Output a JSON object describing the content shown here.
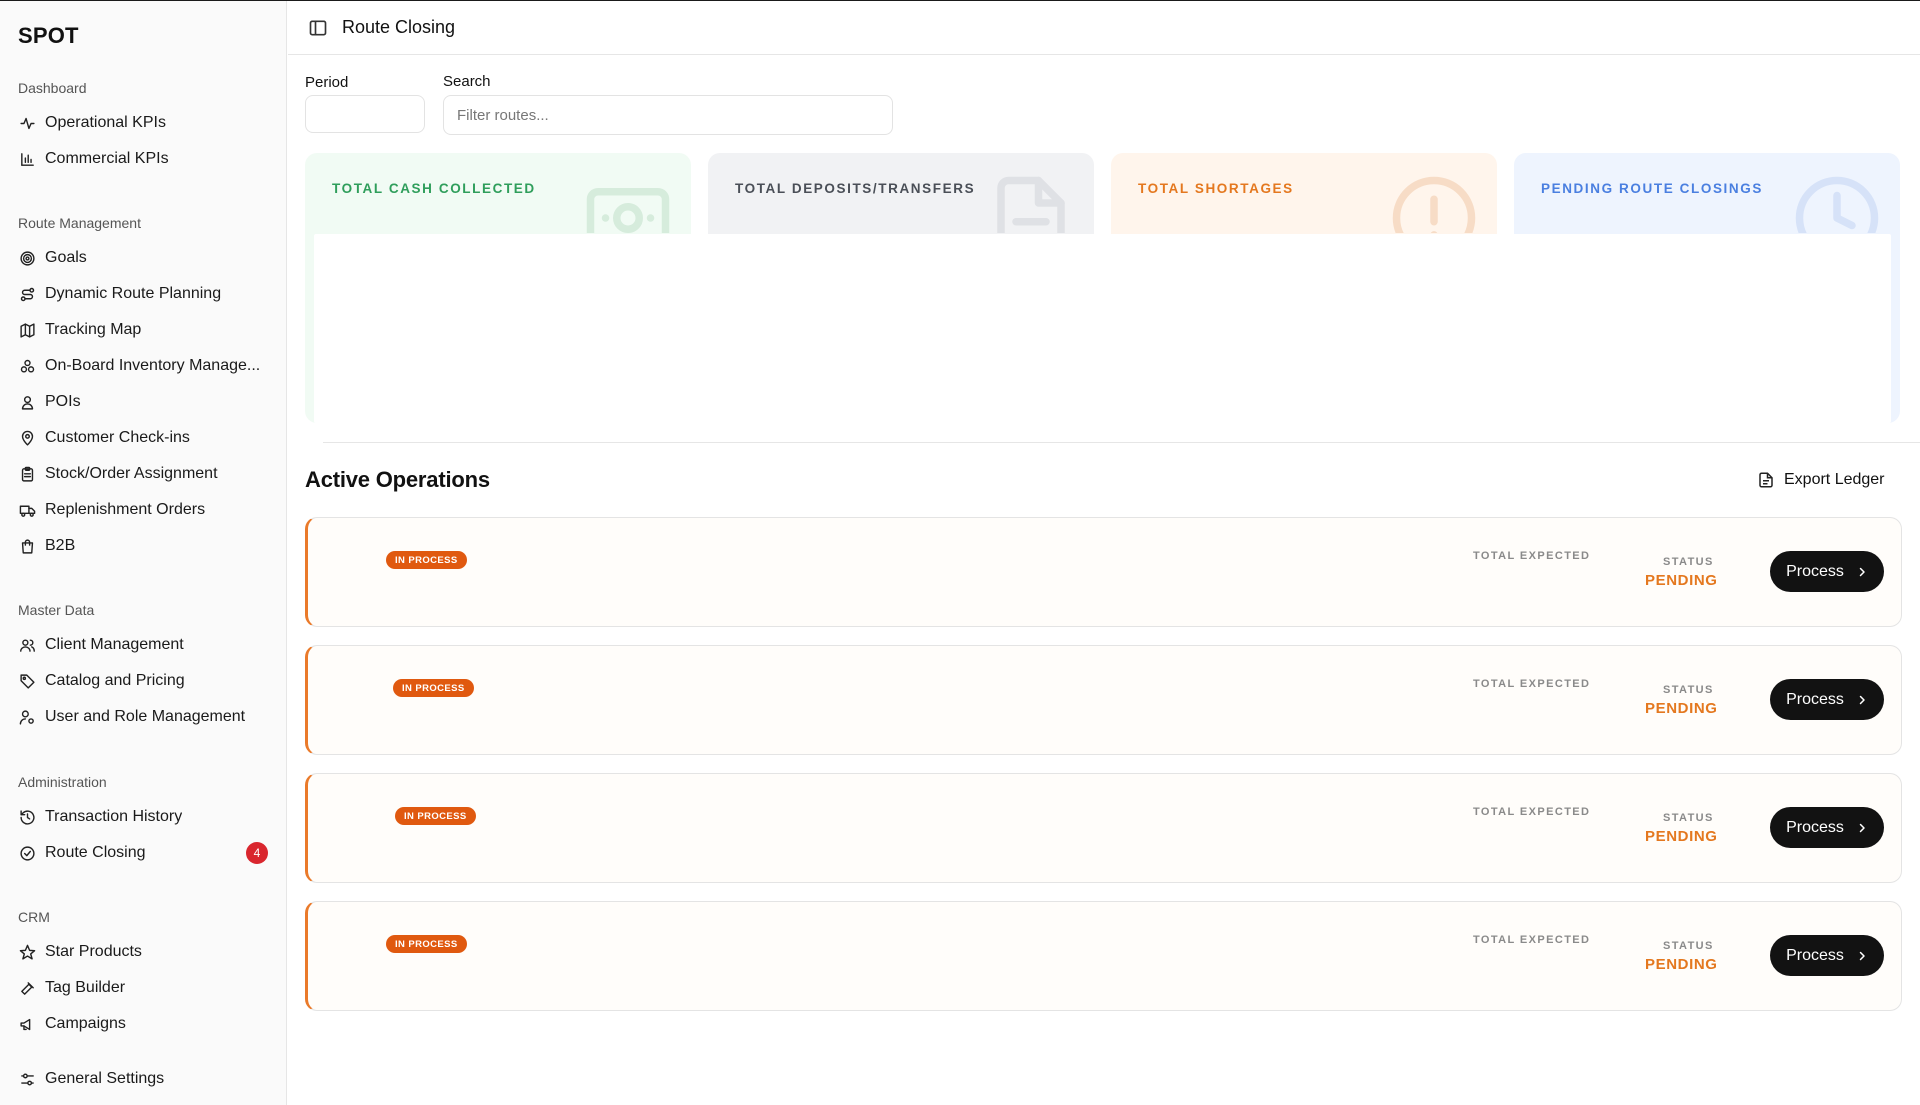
{
  "app": {
    "brand": "SPOT",
    "page_title": "Route Closing"
  },
  "sidebar": {
    "sections": [
      {
        "label": "Dashboard",
        "items": [
          {
            "label": "Operational KPIs",
            "icon": "activity-icon"
          },
          {
            "label": "Commercial KPIs",
            "icon": "bar-chart-icon"
          }
        ]
      },
      {
        "label": "Route Management",
        "items": [
          {
            "label": "Goals",
            "icon": "target-icon"
          },
          {
            "label": "Dynamic Route Planning",
            "icon": "route-icon"
          },
          {
            "label": "Tracking Map",
            "icon": "map-icon"
          },
          {
            "label": "On-Board Inventory Manage...",
            "icon": "boxes-icon"
          },
          {
            "label": "POIs",
            "icon": "user-pin-icon"
          },
          {
            "label": "Customer Check-ins",
            "icon": "map-pin-icon"
          },
          {
            "label": "Stock/Order Assignment",
            "icon": "clipboard-icon"
          },
          {
            "label": "Replenishment Orders",
            "icon": "truck-icon"
          },
          {
            "label": "B2B",
            "icon": "shopping-bag-icon"
          }
        ]
      },
      {
        "label": "Master Data",
        "items": [
          {
            "label": "Client Management",
            "icon": "users-icon"
          },
          {
            "label": "Catalog and Pricing",
            "icon": "tag-icon"
          },
          {
            "label": "User and Role Management",
            "icon": "user-cog-icon"
          }
        ]
      },
      {
        "label": "Administration",
        "items": [
          {
            "label": "Transaction History",
            "icon": "history-icon"
          },
          {
            "label": "Route Closing",
            "icon": "check-circle-icon",
            "badge": "4"
          }
        ]
      },
      {
        "label": "CRM",
        "items": [
          {
            "label": "Star Products",
            "icon": "star-icon"
          },
          {
            "label": "Tag Builder",
            "icon": "hammer-icon"
          },
          {
            "label": "Campaigns",
            "icon": "megaphone-icon"
          }
        ]
      }
    ],
    "footer_item": {
      "label": "General Settings",
      "icon": "settings-sliders-icon"
    }
  },
  "filters": {
    "period_label": "Period",
    "search_label": "Search",
    "search_placeholder": "Filter routes..."
  },
  "kpis": [
    {
      "title": "TOTAL CASH COLLECTED",
      "icon": "banknote-icon",
      "bg": "#f1fbf4",
      "color": "#2f9e5b",
      "icon_color": "#d6ecdc"
    },
    {
      "title": "TOTAL DEPOSITS/TRANSFERS",
      "icon": "file-text-icon",
      "bg": "#f1f2f4",
      "color": "#4a4f57",
      "icon_color": "#dfe1e5"
    },
    {
      "title": "TOTAL SHORTAGES",
      "icon": "alert-circle-icon",
      "bg": "#fff5ec",
      "color": "#e4781f",
      "icon_color": "#f7dcc6"
    },
    {
      "title": "PENDING ROUTE CLOSINGS",
      "icon": "clock-icon",
      "bg": "#eef4fe",
      "color": "#4a7fe0",
      "icon_color": "#d6e2f8"
    }
  ],
  "operations": {
    "title": "Active Operations",
    "export_label": "Export Ledger",
    "rows": [
      {
        "tag": "IN PROCESS",
        "total_expected_label": "TOTAL EXPECTED",
        "status_label": "STATUS",
        "status": "PENDING",
        "action": "Process"
      },
      {
        "tag": "IN PROCESS",
        "total_expected_label": "TOTAL EXPECTED",
        "status_label": "STATUS",
        "status": "PENDING",
        "action": "Process"
      },
      {
        "tag": "IN PROCESS",
        "total_expected_label": "TOTAL EXPECTED",
        "status_label": "STATUS",
        "status": "PENDING",
        "action": "Process"
      },
      {
        "tag": "IN PROCESS",
        "total_expected_label": "TOTAL EXPECTED",
        "status_label": "STATUS",
        "status": "PENDING",
        "action": "Process"
      }
    ]
  }
}
